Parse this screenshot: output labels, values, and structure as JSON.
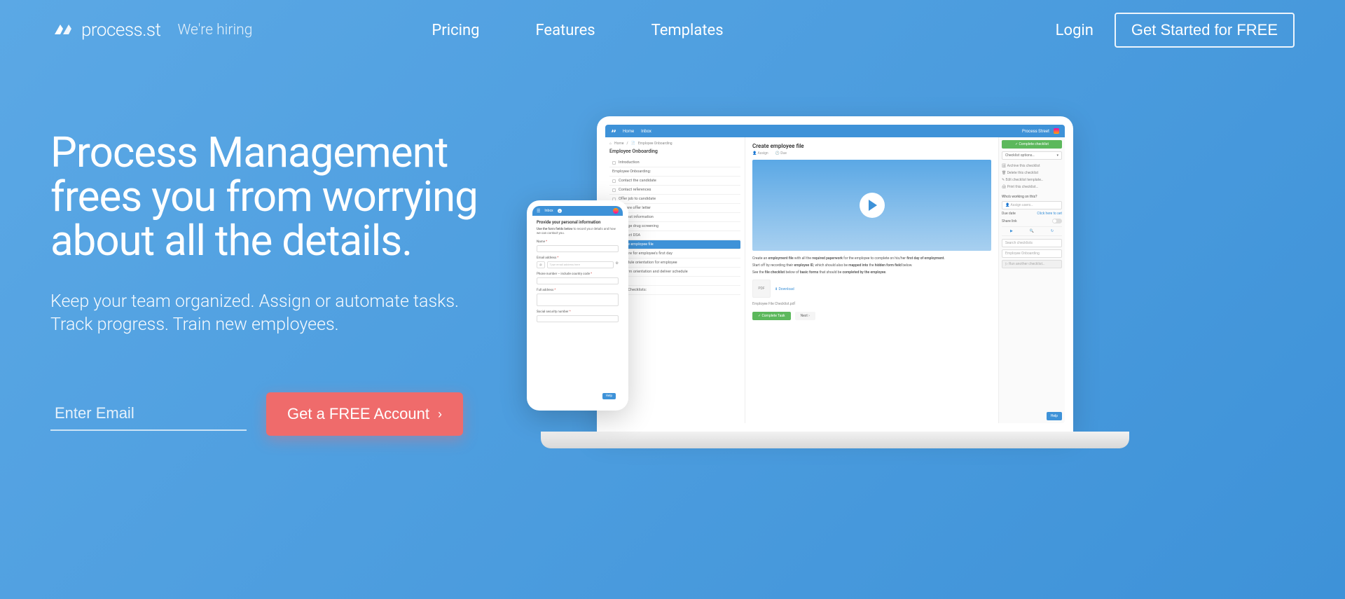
{
  "header": {
    "logo_text": "process.st",
    "hiring_text": "We're hiring",
    "nav": {
      "pricing": "Pricing",
      "features": "Features",
      "templates": "Templates"
    },
    "login": "Login",
    "get_started": "Get Started for FREE"
  },
  "hero": {
    "title": "Process Management frees you from worrying about all the details.",
    "subtitle": "Keep your team organized. Assign or automate tasks. Track progress. Train new employees.",
    "email_placeholder": "Enter Email",
    "cta": "Get a FREE Account"
  },
  "laptop_app": {
    "topbar": {
      "home": "Home",
      "inbox": "Inbox",
      "org": "Process Street"
    },
    "breadcrumb": {
      "home": "Home",
      "current": "Employee Onboarding"
    },
    "sidebar": {
      "title": "Employee Onboarding",
      "tasks": [
        {
          "label": "Introduction"
        },
        {
          "label": "Employee Onboarding:"
        },
        {
          "label": "Contact the candidate"
        },
        {
          "label": "Contact references"
        },
        {
          "label": "Offer job to candidate"
        },
        {
          "label": "Prepare offer letter"
        },
        {
          "label": "Request information"
        },
        {
          "label": "Arrange drug screening"
        },
        {
          "label": "Contact DSA"
        },
        {
          "label": "Create employee file"
        },
        {
          "label": "Prepare for employee's first day"
        },
        {
          "label": "Schedule orientation for employee"
        },
        {
          "label": "Confirm orientation and deliver schedule"
        },
        {
          "label": "Sources:"
        },
        {
          "label": "Relevant Checklists:"
        }
      ]
    },
    "main": {
      "title": "Create employee file",
      "assign": "Assign",
      "due": "Due",
      "text1_prefix": "Create an ",
      "text1_b1": "employment file",
      "text1_mid1": " with all the ",
      "text1_b2": "required paperwork",
      "text1_mid2": " for the employee to complete on his/her ",
      "text1_b3": "first day of employment",
      "text1_suffix": ".",
      "text2_prefix": "Start off by recording their ",
      "text2_b1": "employee ID",
      "text2_mid1": ", which should also be ",
      "text2_b2": "mapped into",
      "text2_mid2": " the ",
      "text2_b3": "hidden form field",
      "text2_suffix": " below.",
      "text3_prefix": "See the ",
      "text3_b1": "file checklist",
      "text3_mid1": " below of ",
      "text3_b2": "basic forms",
      "text3_mid2": " that should be ",
      "text3_b3": "completed by the employee",
      "text3_suffix": ".",
      "pdf_label": "PDF",
      "download": "Download",
      "pdf_name": "Employee File Checklist.pdf",
      "complete_task": "Complete Task",
      "next": "Next"
    },
    "rightbar": {
      "complete_checklist": "Complete checklist",
      "options": "Checklist options…",
      "links": [
        "Archive this checklist",
        "Delete this checklist",
        "Edit checklist template…",
        "Print this checklist…"
      ],
      "working_title": "Who's working on this?",
      "assign_users": "Assign users…",
      "due_date_label": "Due date",
      "due_date_action": "Click here to set",
      "share_link": "Share link",
      "toggle_off": "off",
      "search_checklists": "Search checklists",
      "onboarding_item": "Employee Onboarding",
      "run_another": "Run another checklist…"
    },
    "help": "Help"
  },
  "phone_app": {
    "inbox": "Inbox",
    "badge": "3",
    "section_title": "Provide your personal information",
    "intro1": "Use the form fields below",
    "intro2": " to record your details and how we can contact you.",
    "fields": {
      "name": "Name",
      "email": "Email address",
      "email_placeholder": "Type email address here",
      "phone": "Phone number – include country code",
      "full_address": "Full address",
      "ssn": "Social security number"
    },
    "help": "Help"
  }
}
